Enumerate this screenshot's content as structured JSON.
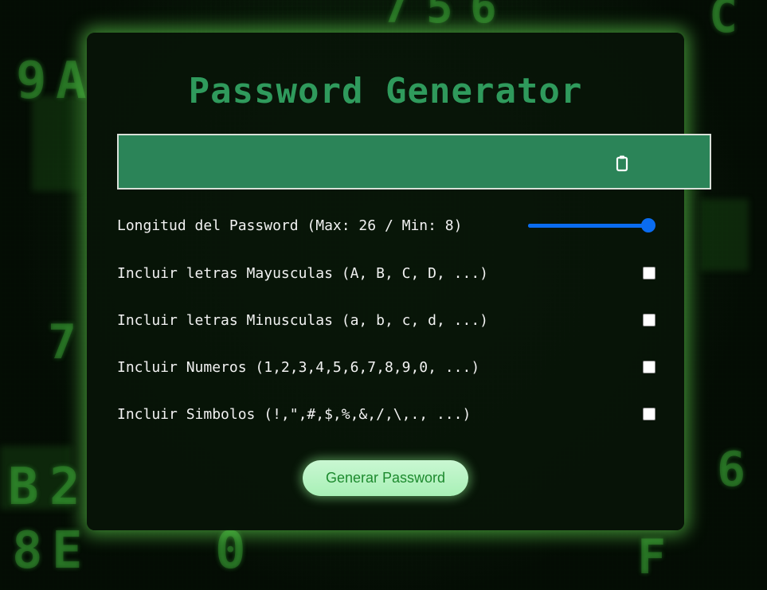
{
  "background": {
    "glyphs": [
      "7",
      "5",
      "6",
      "9",
      "A",
      "C",
      "B",
      "2",
      "8",
      "E",
      "0",
      "7",
      "F",
      "6"
    ]
  },
  "app": {
    "title": "Password Generator"
  },
  "output": {
    "value": "",
    "placeholder": "",
    "copy_icon": "clipboard-icon"
  },
  "length": {
    "label": "Longitud del Password (Max: 26 / Min: 8)",
    "min": 8,
    "max": 26,
    "value": 26
  },
  "options": [
    {
      "label": "Incluir letras Mayusculas (A, B, C, D, ...)",
      "checked": false
    },
    {
      "label": "Incluir letras Minusculas (a, b, c, d, ...)",
      "checked": false
    },
    {
      "label": "Incluir Numeros (1,2,3,4,5,6,7,8,9,0, ...)",
      "checked": false
    },
    {
      "label": "Incluir Simbolos (!,\",#,$,%,&,/,\\,., ...)",
      "checked": false
    }
  ],
  "generate_button": {
    "label": "Generar Password"
  },
  "colors": {
    "title": "#2f9a5c",
    "output_bg": "#2b8458",
    "slider": "#0a6cf0",
    "button_bg": "#c9f7d2",
    "button_text": "#1d8a2e",
    "card_glow": "#6ef05a"
  }
}
